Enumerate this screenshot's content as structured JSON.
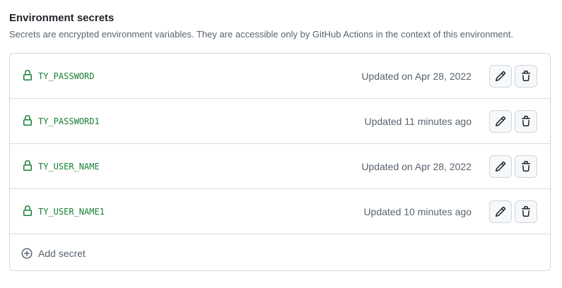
{
  "section": {
    "title": "Environment secrets",
    "description": "Secrets are encrypted environment variables. They are accessible only by GitHub Actions in the context of this environment."
  },
  "secrets": [
    {
      "name": "TY_PASSWORD",
      "updated": "Updated on Apr 28, 2022"
    },
    {
      "name": "TY_PASSWORD1",
      "updated": "Updated 11 minutes ago"
    },
    {
      "name": "TY_USER_NAME",
      "updated": "Updated on Apr 28, 2022"
    },
    {
      "name": "TY_USER_NAME1",
      "updated": "Updated 10 minutes ago"
    }
  ],
  "actions": {
    "edit_icon": "pencil-icon",
    "delete_icon": "trash-icon",
    "add_secret_label": "Add secret",
    "add_icon": "plus-circle-icon"
  },
  "colors": {
    "secret_name": "#1a7f37",
    "muted_text": "#59636e",
    "border": "#d0d7de",
    "button_bg": "#f6f8fa"
  }
}
